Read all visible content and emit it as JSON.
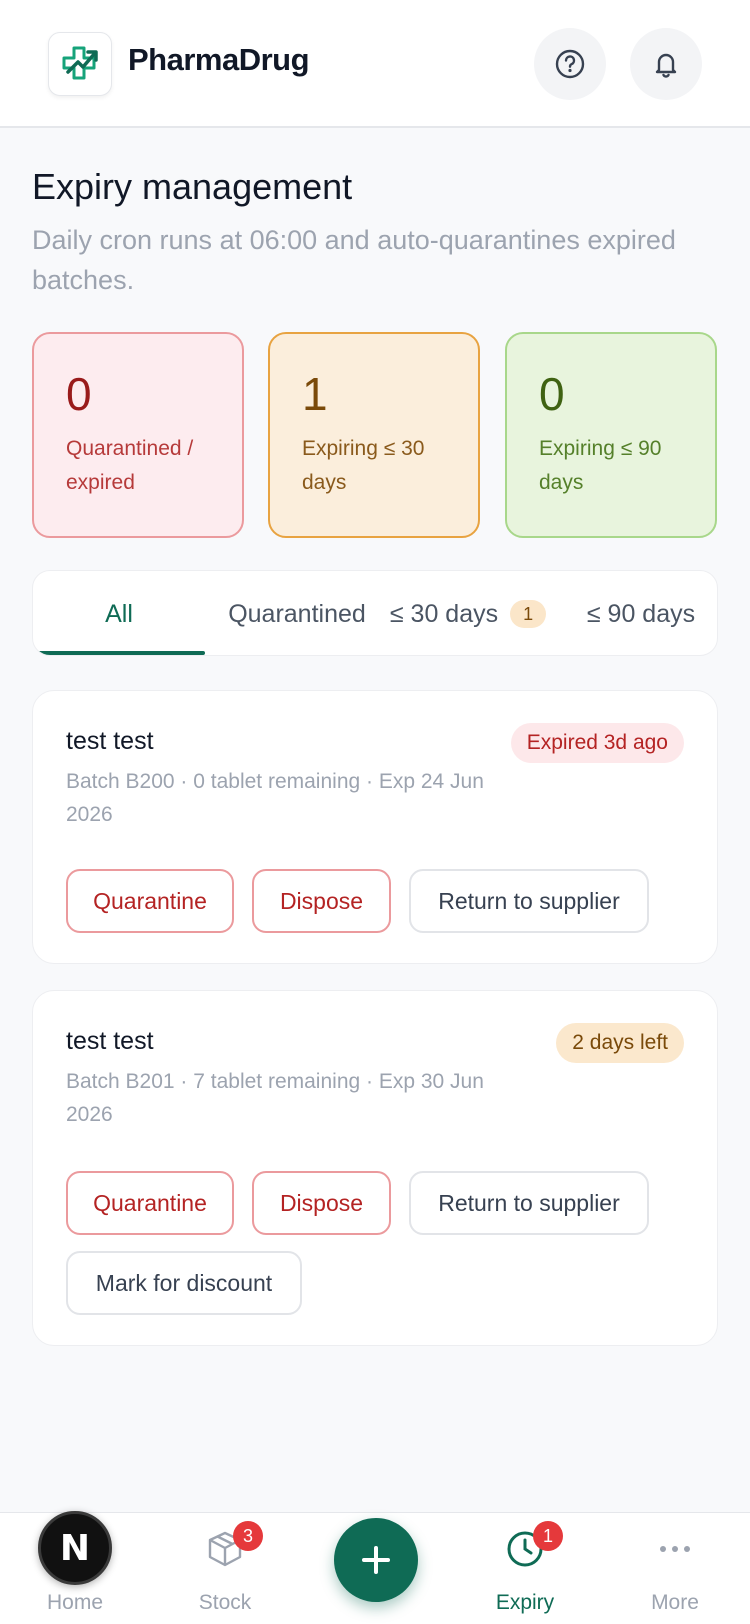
{
  "app": {
    "brand": "PharmaDrug",
    "colors": {
      "accent": "#0f6b55",
      "danger": "#b42323",
      "warning": "#e8a341",
      "success": "#a8d78a"
    }
  },
  "header": {
    "help_icon": "help-circle-icon",
    "notifications_icon": "bell-icon"
  },
  "page": {
    "title": "Expiry management",
    "subtitle": "Daily cron runs at 06:00 and auto-quarantines expired batches."
  },
  "stats": [
    {
      "value": "0",
      "label": "Quarantined / expired"
    },
    {
      "value": "1",
      "label": "Expiring ≤ 30 days"
    },
    {
      "value": "0",
      "label": "Expiring ≤ 90 days"
    }
  ],
  "tabs": [
    {
      "label": "All",
      "active": true
    },
    {
      "label": "Quarantined"
    },
    {
      "label": "≤ 30 days",
      "badge": "1"
    },
    {
      "label": "≤ 90 days"
    }
  ],
  "batches": [
    {
      "name": "test test",
      "status": "Expired 3d ago",
      "meta": "Batch B200 · 0 tablet remaining · Exp 24 Jun 2026",
      "actions": [
        "Quarantine",
        "Dispose",
        "Return to supplier"
      ]
    },
    {
      "name": "test test",
      "status": "2 days left",
      "meta": "Batch B201 · 7 tablet remaining · Exp 30 Jun 2026",
      "actions": [
        "Quarantine",
        "Dispose",
        "Return to supplier",
        "Mark for discount"
      ]
    }
  ],
  "bottom_nav": {
    "avatar_letter": "N",
    "items": [
      {
        "label": "Home",
        "icon": "home-icon"
      },
      {
        "label": "Stock",
        "icon": "box-icon",
        "badge": "3"
      },
      {
        "label": "Expiry",
        "icon": "clock-icon",
        "badge": "1",
        "active": true
      },
      {
        "label": "More",
        "icon": "more-dots-icon"
      }
    ],
    "fab_label": "+"
  }
}
